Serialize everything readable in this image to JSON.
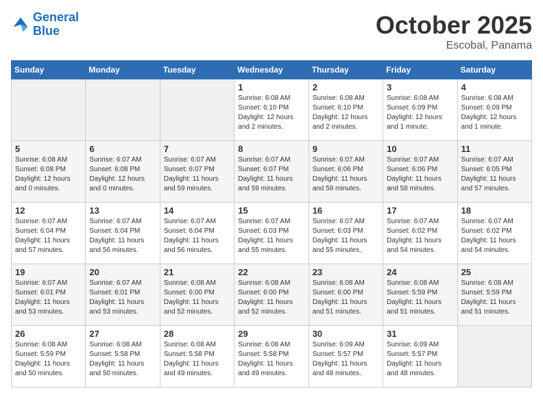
{
  "header": {
    "logo_general": "General",
    "logo_blue": "Blue",
    "month": "October 2025",
    "location": "Escobal, Panama"
  },
  "weekdays": [
    "Sunday",
    "Monday",
    "Tuesday",
    "Wednesday",
    "Thursday",
    "Friday",
    "Saturday"
  ],
  "weeks": [
    [
      {
        "day": "",
        "info": ""
      },
      {
        "day": "",
        "info": ""
      },
      {
        "day": "",
        "info": ""
      },
      {
        "day": "1",
        "info": "Sunrise: 6:08 AM\nSunset: 6:10 PM\nDaylight: 12 hours\nand 2 minutes."
      },
      {
        "day": "2",
        "info": "Sunrise: 6:08 AM\nSunset: 6:10 PM\nDaylight: 12 hours\nand 2 minutes."
      },
      {
        "day": "3",
        "info": "Sunrise: 6:08 AM\nSunset: 6:09 PM\nDaylight: 12 hours\nand 1 minute."
      },
      {
        "day": "4",
        "info": "Sunrise: 6:08 AM\nSunset: 6:09 PM\nDaylight: 12 hours\nand 1 minute."
      }
    ],
    [
      {
        "day": "5",
        "info": "Sunrise: 6:08 AM\nSunset: 6:08 PM\nDaylight: 12 hours\nand 0 minutes."
      },
      {
        "day": "6",
        "info": "Sunrise: 6:07 AM\nSunset: 6:08 PM\nDaylight: 12 hours\nand 0 minutes."
      },
      {
        "day": "7",
        "info": "Sunrise: 6:07 AM\nSunset: 6:07 PM\nDaylight: 11 hours\nand 59 minutes."
      },
      {
        "day": "8",
        "info": "Sunrise: 6:07 AM\nSunset: 6:07 PM\nDaylight: 11 hours\nand 59 minutes."
      },
      {
        "day": "9",
        "info": "Sunrise: 6:07 AM\nSunset: 6:06 PM\nDaylight: 11 hours\nand 58 minutes."
      },
      {
        "day": "10",
        "info": "Sunrise: 6:07 AM\nSunset: 6:06 PM\nDaylight: 11 hours\nand 58 minutes."
      },
      {
        "day": "11",
        "info": "Sunrise: 6:07 AM\nSunset: 6:05 PM\nDaylight: 11 hours\nand 57 minutes."
      }
    ],
    [
      {
        "day": "12",
        "info": "Sunrise: 6:07 AM\nSunset: 6:04 PM\nDaylight: 11 hours\nand 57 minutes."
      },
      {
        "day": "13",
        "info": "Sunrise: 6:07 AM\nSunset: 6:04 PM\nDaylight: 11 hours\nand 56 minutes."
      },
      {
        "day": "14",
        "info": "Sunrise: 6:07 AM\nSunset: 6:04 PM\nDaylight: 11 hours\nand 56 minutes."
      },
      {
        "day": "15",
        "info": "Sunrise: 6:07 AM\nSunset: 6:03 PM\nDaylight: 11 hours\nand 55 minutes."
      },
      {
        "day": "16",
        "info": "Sunrise: 6:07 AM\nSunset: 6:03 PM\nDaylight: 11 hours\nand 55 minutes."
      },
      {
        "day": "17",
        "info": "Sunrise: 6:07 AM\nSunset: 6:02 PM\nDaylight: 11 hours\nand 54 minutes."
      },
      {
        "day": "18",
        "info": "Sunrise: 6:07 AM\nSunset: 6:02 PM\nDaylight: 11 hours\nand 54 minutes."
      }
    ],
    [
      {
        "day": "19",
        "info": "Sunrise: 6:07 AM\nSunset: 6:01 PM\nDaylight: 11 hours\nand 53 minutes."
      },
      {
        "day": "20",
        "info": "Sunrise: 6:07 AM\nSunset: 6:01 PM\nDaylight: 11 hours\nand 53 minutes."
      },
      {
        "day": "21",
        "info": "Sunrise: 6:08 AM\nSunset: 6:00 PM\nDaylight: 11 hours\nand 52 minutes."
      },
      {
        "day": "22",
        "info": "Sunrise: 6:08 AM\nSunset: 6:00 PM\nDaylight: 11 hours\nand 52 minutes."
      },
      {
        "day": "23",
        "info": "Sunrise: 6:08 AM\nSunset: 6:00 PM\nDaylight: 11 hours\nand 51 minutes."
      },
      {
        "day": "24",
        "info": "Sunrise: 6:08 AM\nSunset: 5:59 PM\nDaylight: 11 hours\nand 51 minutes."
      },
      {
        "day": "25",
        "info": "Sunrise: 6:08 AM\nSunset: 5:59 PM\nDaylight: 11 hours\nand 51 minutes."
      }
    ],
    [
      {
        "day": "26",
        "info": "Sunrise: 6:08 AM\nSunset: 5:59 PM\nDaylight: 11 hours\nand 50 minutes."
      },
      {
        "day": "27",
        "info": "Sunrise: 6:08 AM\nSunset: 5:58 PM\nDaylight: 11 hours\nand 50 minutes."
      },
      {
        "day": "28",
        "info": "Sunrise: 6:08 AM\nSunset: 5:58 PM\nDaylight: 11 hours\nand 49 minutes."
      },
      {
        "day": "29",
        "info": "Sunrise: 6:08 AM\nSunset: 5:58 PM\nDaylight: 11 hours\nand 49 minutes."
      },
      {
        "day": "30",
        "info": "Sunrise: 6:09 AM\nSunset: 5:57 PM\nDaylight: 11 hours\nand 48 minutes."
      },
      {
        "day": "31",
        "info": "Sunrise: 6:09 AM\nSunset: 5:57 PM\nDaylight: 11 hours\nand 48 minutes."
      },
      {
        "day": "",
        "info": ""
      }
    ]
  ]
}
